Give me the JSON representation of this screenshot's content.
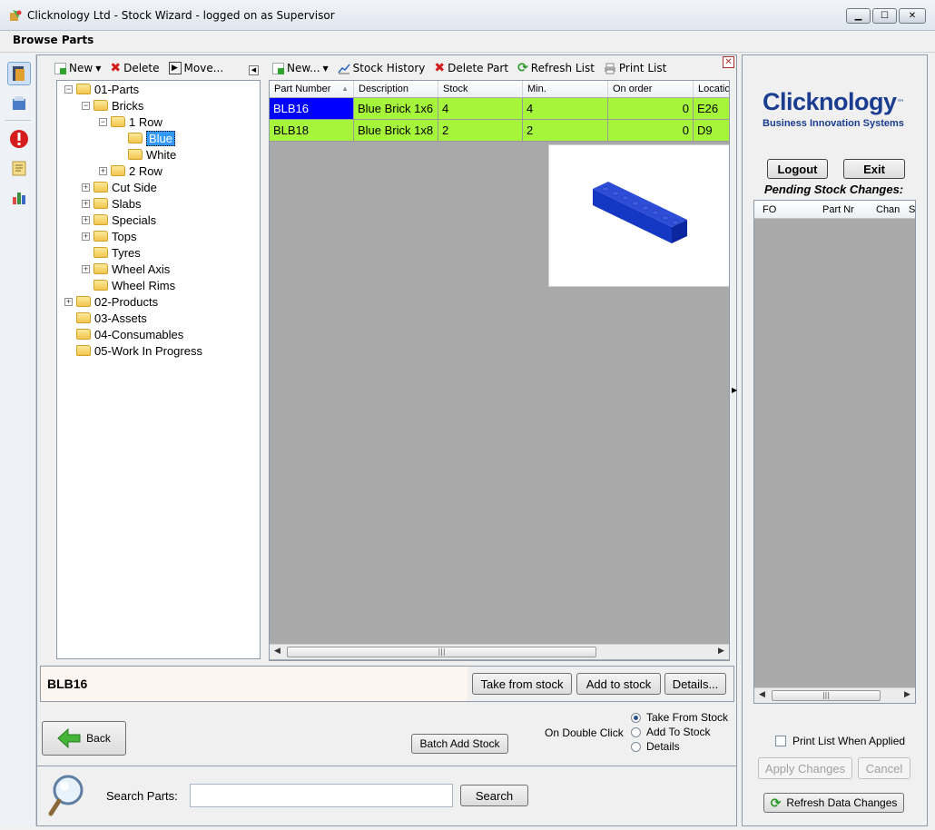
{
  "window": {
    "title": "Clicknology Ltd - Stock Wizard - logged on as Supervisor"
  },
  "page": {
    "heading": "Browse Parts"
  },
  "icons": {
    "app": "app-icon",
    "minimize": "minimize-icon",
    "maximize": "maximize-icon",
    "close": "close-icon"
  },
  "tree_toolbar": {
    "new": "New",
    "delete": "Delete",
    "move": "Move..."
  },
  "tree": [
    {
      "label": "01-Parts",
      "level": 0,
      "expander": "−"
    },
    {
      "label": "Bricks",
      "level": 1,
      "expander": "−"
    },
    {
      "label": "1 Row",
      "level": 2,
      "expander": "−"
    },
    {
      "label": "Blue",
      "level": 3,
      "expander": "",
      "selected": true
    },
    {
      "label": "White",
      "level": 3,
      "expander": ""
    },
    {
      "label": "2 Row",
      "level": 2,
      "expander": "+"
    },
    {
      "label": "Cut Side",
      "level": 1,
      "expander": "+"
    },
    {
      "label": "Slabs",
      "level": 1,
      "expander": "+"
    },
    {
      "label": "Specials",
      "level": 1,
      "expander": "+"
    },
    {
      "label": "Tops",
      "level": 1,
      "expander": "+"
    },
    {
      "label": "Tyres",
      "level": 1,
      "expander": ""
    },
    {
      "label": "Wheel Axis",
      "level": 1,
      "expander": "+"
    },
    {
      "label": "Wheel Rims",
      "level": 1,
      "expander": ""
    },
    {
      "label": "02-Products",
      "level": 0,
      "expander": "+"
    },
    {
      "label": "03-Assets",
      "level": 0,
      "expander": ""
    },
    {
      "label": "04-Consumables",
      "level": 0,
      "expander": ""
    },
    {
      "label": "05-Work In Progress",
      "level": 0,
      "expander": ""
    }
  ],
  "grid_toolbar": {
    "new": "New...",
    "stock_history": "Stock History",
    "delete_part": "Delete Part",
    "refresh_list": "Refresh List",
    "print_list": "Print List"
  },
  "grid": {
    "columns": [
      "Part Number",
      "Description",
      "Stock",
      "Min.",
      "On order",
      "Locatio"
    ],
    "rows": [
      {
        "part_number": "BLB16",
        "description": "Blue Brick 1x6",
        "stock": "4",
        "min": "4",
        "on_order": "0",
        "location": "E26"
      },
      {
        "part_number": "BLB18",
        "description": "Blue Brick 1x8",
        "stock": "2",
        "min": "2",
        "on_order": "0",
        "location": "D9"
      }
    ],
    "row_color": "#a5f53a",
    "selected_color": "#0000ff"
  },
  "selection": {
    "part": "BLB16"
  },
  "actions": {
    "take_from_stock": "Take from stock",
    "add_to_stock": "Add to stock",
    "details": "Details..."
  },
  "bottom": {
    "back": "Back",
    "batch_add": "Batch Add Stock",
    "on_double_click": "On Double Click",
    "options": [
      "Take From Stock",
      "Add To Stock",
      "Details"
    ],
    "selected_option": "Take From Stock"
  },
  "search": {
    "label": "Search Parts:",
    "value": "",
    "button": "Search"
  },
  "brand": {
    "name": "Clicknology",
    "tm": "™",
    "tagline": "Business Innovation Systems",
    "color": "#1b3d8f"
  },
  "right": {
    "logout": "Logout",
    "exit": "Exit",
    "pending_title": "Pending Stock Changes:",
    "columns": [
      "FO",
      "Part Nr",
      "Chan",
      "S"
    ],
    "print_when_applied": "Print List When Applied",
    "apply": "Apply Changes",
    "cancel": "Cancel",
    "refresh": "Refresh Data Changes"
  }
}
